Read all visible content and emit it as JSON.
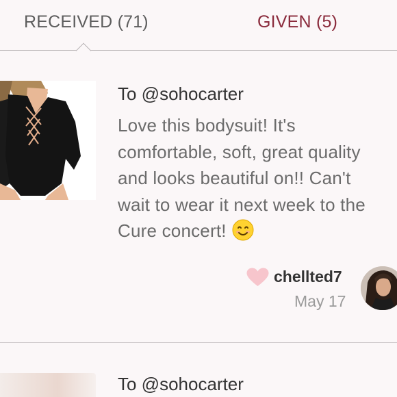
{
  "tabs": {
    "received": {
      "label": "RECEIVED",
      "count": "(71)"
    },
    "given": {
      "label": "GIVEN",
      "count": "(5)"
    }
  },
  "reviews": [
    {
      "to": "To @sohocarter",
      "text_lines": [
        "Love this bodysuit! It's",
        "comfortable, soft, great quality",
        "and looks beautiful on!! Can't",
        "wait to wear it next week to the",
        "Cure concert!"
      ],
      "emoji": "smiling-face-icon",
      "liked": true,
      "username": "chellted7",
      "date": "May 17"
    },
    {
      "to": "To @sohocarter"
    }
  ],
  "colors": {
    "background": "#fbf7f8",
    "given_tab": "#8a2a3b",
    "heart": "#f7c5cc",
    "divider": "#cdc8ca"
  }
}
